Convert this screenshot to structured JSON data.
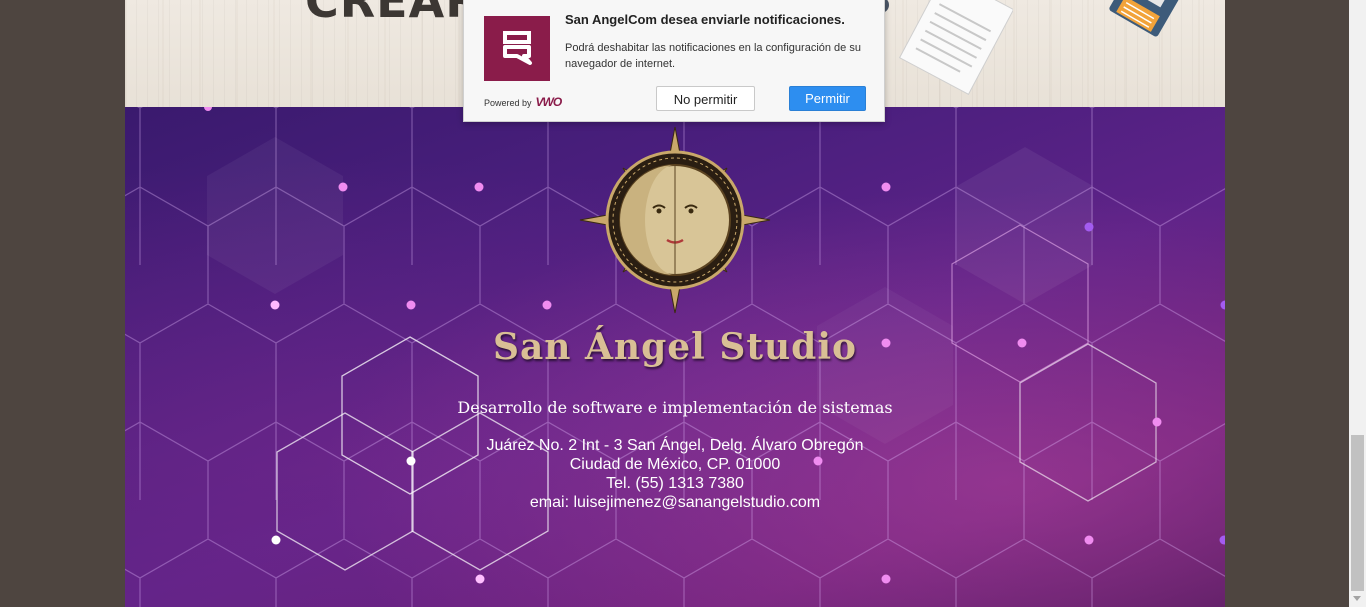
{
  "banner": {
    "word": "CREAR"
  },
  "footer": {
    "studio_name": "San Ángel Studio",
    "tagline": "Desarrollo de software e implementación de sistemas",
    "address_line1": "Juárez No. 2 Int - 3 San Ángel, Delg. Álvaro Obregón",
    "address_line2": "Ciudad de México, CP. 01000",
    "phone": "Tel. (55) 1313 7380",
    "email": "emai: luisejimenez@sanangelstudio.com"
  },
  "notification": {
    "title": "San AngelCom desea enviarle notificaciones.",
    "body": "Podrá deshabitar las notificaciones en la configuración de su navegador de internet.",
    "powered_by": "Powered by",
    "brand": "VWO",
    "deny_label": "No permitir",
    "allow_label": "Permitir"
  },
  "colors": {
    "brand": "#8a1c4a",
    "allow_button": "#2d8ef0",
    "gold": "#d9bf95",
    "footer_purple": "#5e2388"
  },
  "icons": [
    "chat-bubble-logo-icon",
    "floppy-disk-icon",
    "sun-moon-compass-logo"
  ]
}
